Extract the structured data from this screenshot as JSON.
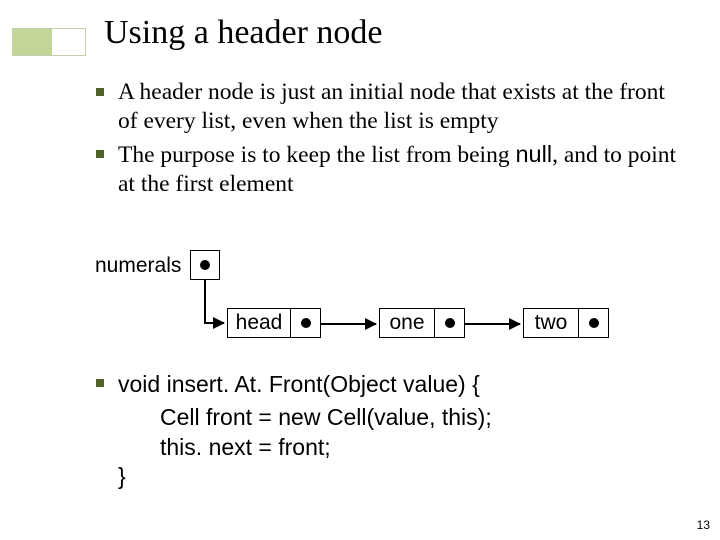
{
  "title": "Using a header node",
  "bullets": {
    "b1a": "A header node is just an initial node that exists at the front of every list, even when the list is empty",
    "b2a": "The purpose is to keep the list from being ",
    "b2null": "null",
    "b2b": ", and to point at the first element"
  },
  "diagram": {
    "numerals": "numerals",
    "head": "head",
    "one": "one",
    "two": "two"
  },
  "code": {
    "l1": "void insert. At. Front(Object value) {",
    "l2": "Cell front = new Cell(value, this);",
    "l3": "this. next = front;",
    "l4": "}"
  },
  "page": "13"
}
